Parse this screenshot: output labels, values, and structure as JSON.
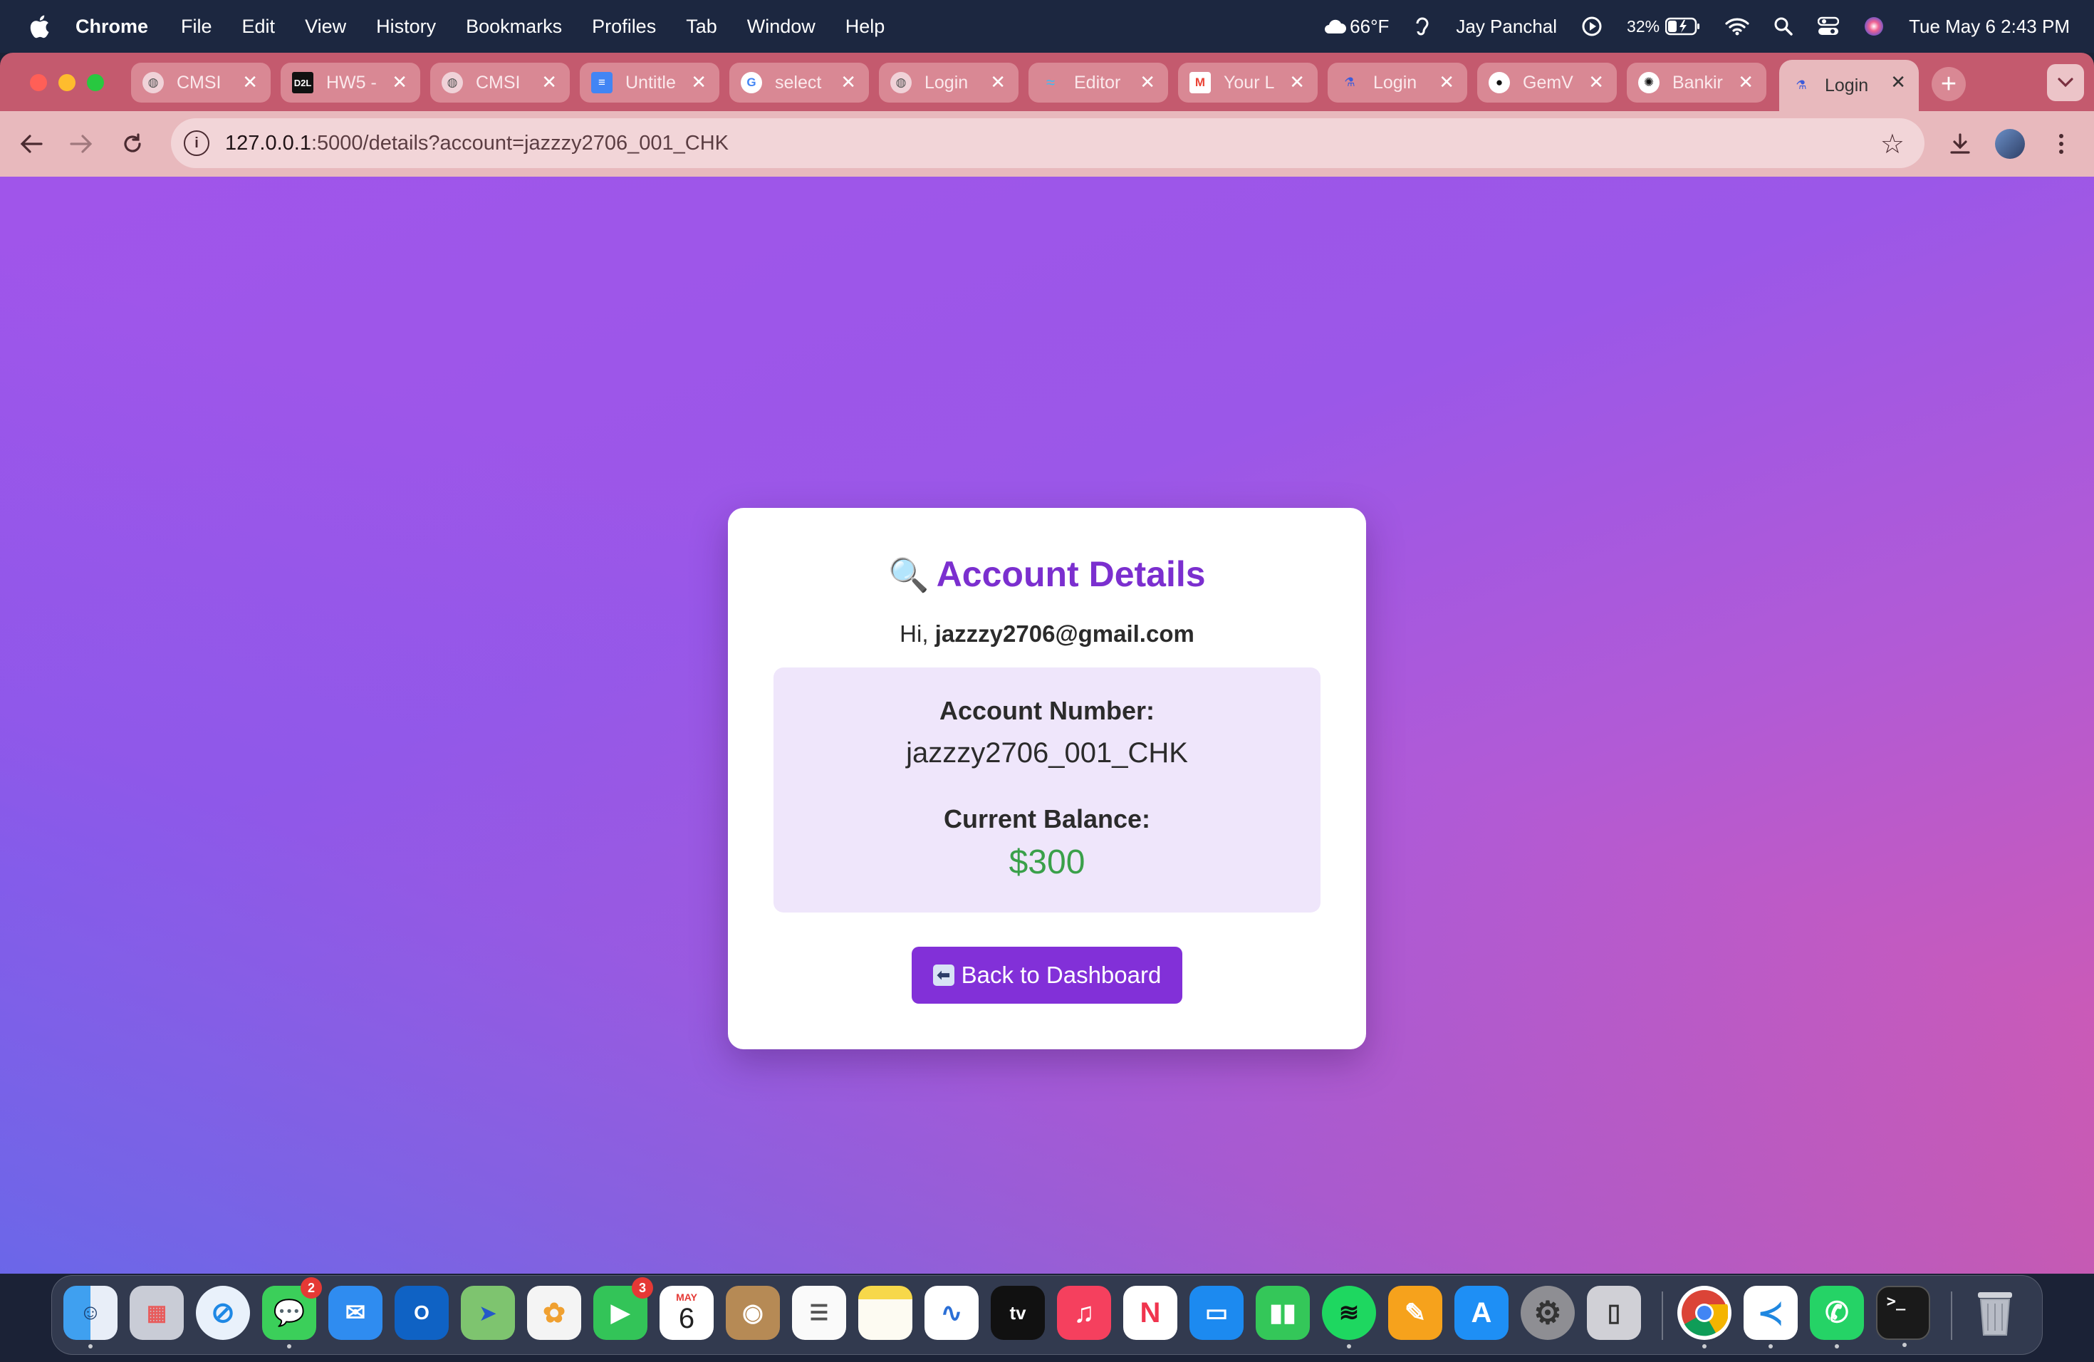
{
  "menubar": {
    "app_name": "Chrome",
    "menus": [
      "File",
      "Edit",
      "View",
      "History",
      "Bookmarks",
      "Profiles",
      "Tab",
      "Window",
      "Help"
    ],
    "weather": "66°F",
    "user": "Jay Panchal",
    "battery": "32%",
    "datetime": "Tue May 6  2:43 PM"
  },
  "tabs": [
    {
      "title": "CMSI",
      "favicon": "globe-icon"
    },
    {
      "title": "HW5 -",
      "favicon": "d2l-icon"
    },
    {
      "title": "CMSI",
      "favicon": "globe-icon"
    },
    {
      "title": "Untitle",
      "favicon": "docs-icon"
    },
    {
      "title": "select",
      "favicon": "google-icon"
    },
    {
      "title": "Login",
      "favicon": "globe-icon"
    },
    {
      "title": "Editor",
      "favicon": "tailwind-icon"
    },
    {
      "title": "Your L",
      "favicon": "gmail-icon"
    },
    {
      "title": "Login",
      "favicon": "flask-icon"
    },
    {
      "title": "GemV",
      "favicon": "github-icon"
    },
    {
      "title": "Bankir",
      "favicon": "openai-icon"
    },
    {
      "title": "Login",
      "favicon": "flask-icon",
      "active": true
    }
  ],
  "address_bar": {
    "host": "127.0.0.1",
    "path": ":5000/details?account=jazzzy2706_001_CHK"
  },
  "card": {
    "title": "Account Details",
    "greeting_prefix": "Hi, ",
    "email": "jazzzy2706@gmail.com",
    "account_number_label": "Account Number:",
    "account_number": "jazzzy2706_001_CHK",
    "balance_label": "Current Balance:",
    "balance": "$300",
    "back_button_label": "Back to Dashboard"
  },
  "dock": {
    "apps": [
      "finder-icon",
      "launchpad-icon",
      "safari-icon",
      "messages-icon",
      "mail-icon",
      "outlook-icon",
      "maps-icon",
      "photos-icon",
      "facetime-icon",
      "calendar-icon",
      "contacts-icon",
      "reminders-icon",
      "notes-icon",
      "freeform-icon",
      "tv-icon",
      "music-icon",
      "news-icon",
      "keynote-icon",
      "numbers-icon",
      "spotify-icon",
      "pages-icon",
      "appstore-icon",
      "settings-icon",
      "iphone-mirroring-icon",
      "chrome-icon",
      "vscode-icon",
      "whatsapp-icon",
      "terminal-icon",
      "trash-icon"
    ],
    "messages_badge": "2",
    "facetime_badge": "3",
    "calendar_month": "MAY",
    "calendar_day": "6",
    "tv_label": "tv"
  },
  "colors": {
    "accent": "#8230d8",
    "title": "#7b2fcf",
    "balance": "#3aa04a",
    "info_box": "#efe6fb"
  }
}
